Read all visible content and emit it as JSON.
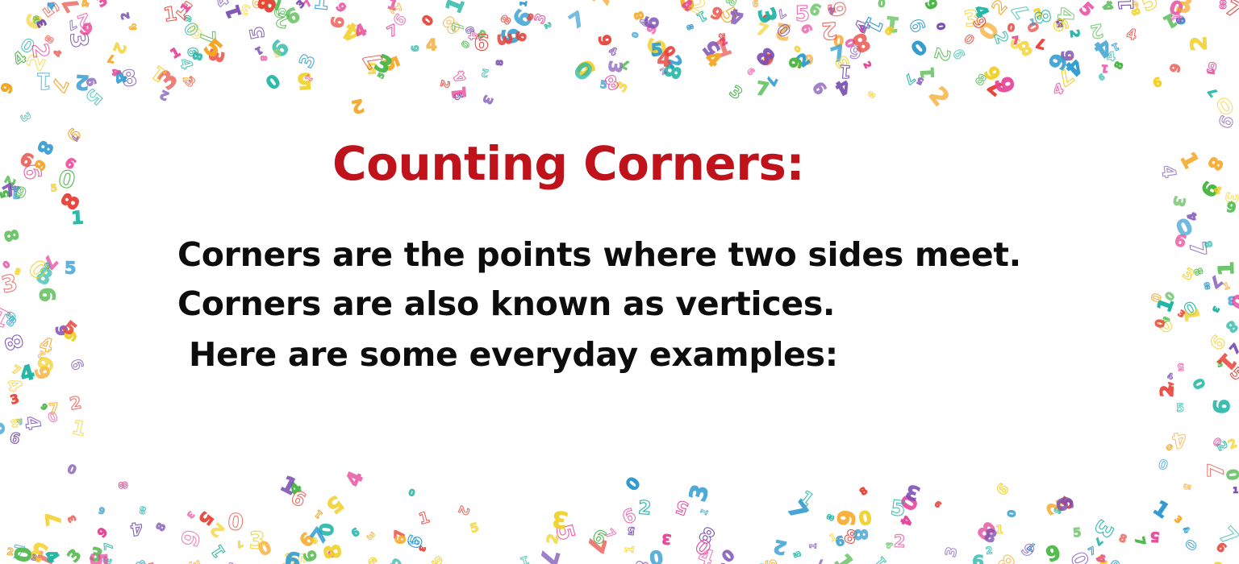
{
  "slide": {
    "title": "Counting Corners:",
    "lines": [
      "Corners are the points where two sides meet.",
      "Corners are also known as vertices.",
      " Here are some everyday examples:"
    ]
  },
  "colors": {
    "title": "#c0121b",
    "text": "#0d0d0d",
    "background": "#ffffff",
    "confetti_palette": [
      "#e8453c",
      "#f5a623",
      "#f2d027",
      "#4cb848",
      "#2e9ad0",
      "#7b4fb3",
      "#e6489c",
      "#1fb5a5"
    ]
  },
  "decoration": {
    "type": "number-confetti-border",
    "glyphs": [
      "0",
      "1",
      "2",
      "3",
      "4",
      "5",
      "6",
      "7",
      "8",
      "9"
    ]
  }
}
